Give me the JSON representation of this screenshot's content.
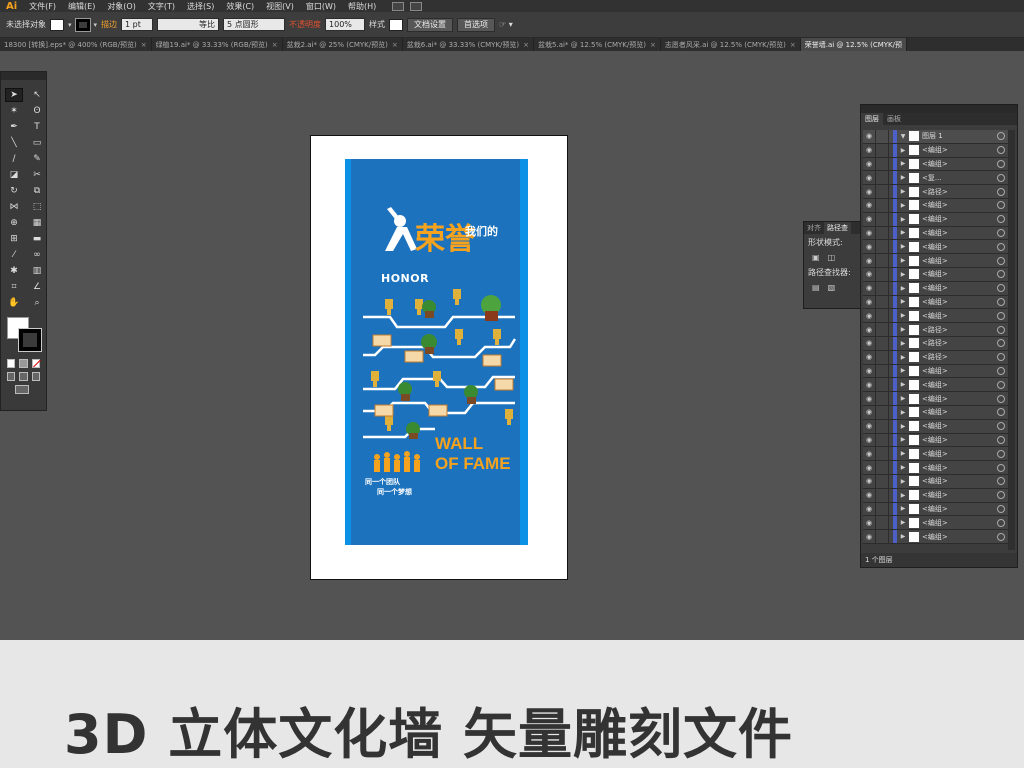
{
  "menubar": {
    "logo": "Ai",
    "items": [
      "文件(F)",
      "编辑(E)",
      "对象(O)",
      "文字(T)",
      "选择(S)",
      "效果(C)",
      "视图(V)",
      "窗口(W)",
      "帮助(H)"
    ]
  },
  "control": {
    "selection": "未选择对象",
    "stroke_label": "描边",
    "stroke_width": "1 pt",
    "line_style": "等比",
    "brush": "5 点圆形",
    "opacity_label": "不透明度",
    "opacity_value": "100%",
    "style_label": "样式",
    "doc_settings": "文档设置",
    "preferences": "首选项"
  },
  "tabs": [
    {
      "label": "18300 [转换].eps* @ 400% (RGB/预览)",
      "active": false
    },
    {
      "label": "绿植19.ai* @ 33.33% (RGB/预览)",
      "active": false
    },
    {
      "label": "盆栽2.ai* @ 25% (CMYK/预览)",
      "active": false
    },
    {
      "label": "盆栽6.ai* @ 33.33% (CMYK/预览)",
      "active": false
    },
    {
      "label": "盆栽5.ai* @ 12.5% (CMYK/预览)",
      "active": false
    },
    {
      "label": "志愿者风采.ai @ 12.5% (CMYK/预览)",
      "active": false
    },
    {
      "label": "荣誉墙.ai @ 12.5% (CMYK/预",
      "active": true
    }
  ],
  "artwork": {
    "title_cn": "荣誉",
    "subtitle_cn": "我们的",
    "honor": "HONOR",
    "wall": "WALL",
    "of_fame": "OF FAME",
    "slogan_1": "同一个团队",
    "slogan_2": "同一个梦想"
  },
  "pathfinder": {
    "tab_align": "对齐",
    "tab_pathfinder": "路径查",
    "shape_modes": "形状模式:",
    "pathfinders": "路径查找器:"
  },
  "layers_panel": {
    "tab_layers": "图层",
    "tab_artboards": "画板",
    "top_layer": "图层 1",
    "rows": [
      "<编组>",
      "<编组>",
      "<复...",
      "<路径>",
      "<编组>",
      "<编组>",
      "<编组>",
      "<编组>",
      "<编组>",
      "<编组>",
      "<编组>",
      "<编组>",
      "<编组>",
      "<路径>",
      "<路径>",
      "<路径>",
      "<编组>",
      "<编组>",
      "<编组>",
      "<编组>",
      "<编组>",
      "<编组>",
      "<编组>",
      "<编组>",
      "<编组>",
      "<编组>",
      "<编组>",
      "<编组>",
      "<编组>"
    ],
    "footer": "1 个图层"
  },
  "bottom_title": "3D 立体文化墙 矢量雕刻文件"
}
